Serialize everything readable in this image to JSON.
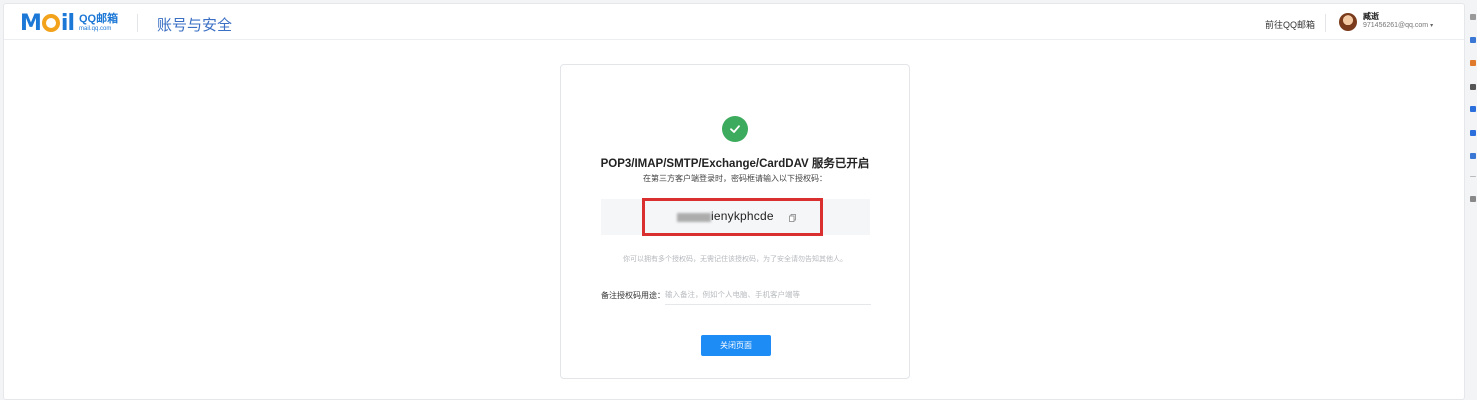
{
  "header": {
    "logo_text": "M",
    "logo_text_end": "il",
    "logo_cn": "QQ邮箱",
    "logo_en": "mail.qq.com",
    "page_title": "账号与安全",
    "goto_link": "前往QQ邮箱",
    "user_name": "臧逝",
    "user_email": "971456261@qq.com",
    "caret": "▾"
  },
  "card": {
    "title": "POP3/IMAP/SMTP/Exchange/CardDAV 服务已开启",
    "subtitle": "在第三方客户端登录时，密码框请输入以下授权码：",
    "auth_code_visible": "ienykphcde",
    "hint": "你可以拥有多个授权码，无需记住该授权码，为了安全请勿告知其他人。",
    "note_label": "备注授权码用途：",
    "note_placeholder": "输入备注，例如个人电脑、手机客户端等",
    "close_button": "关闭页面"
  },
  "colors": {
    "brand_blue": "#1c78d6",
    "success_green": "#3dab5d",
    "highlight_red": "#d9302f",
    "button_blue": "#1e8cf5"
  },
  "icons": [
    "check-icon",
    "copy-icon",
    "chevron-down-icon"
  ]
}
